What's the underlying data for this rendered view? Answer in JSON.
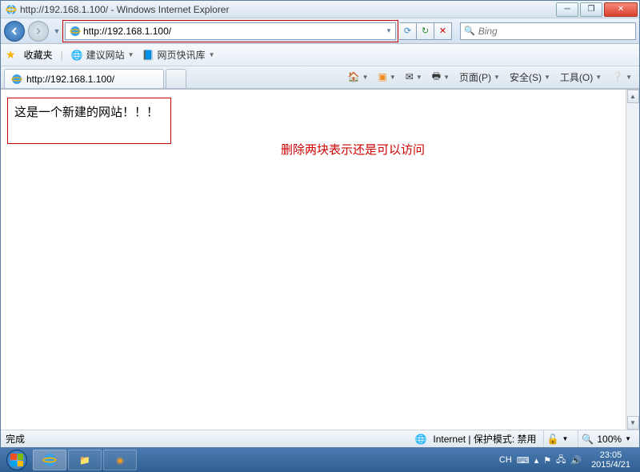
{
  "title": "http://192.168.1.100/ - Windows Internet Explorer",
  "address": {
    "url": "http://192.168.1.100/"
  },
  "search": {
    "placeholder": "Bing"
  },
  "favorites": {
    "label": "收藏夹",
    "suggest_label": "建议网站",
    "slice_label": "网页快讯库"
  },
  "tab": {
    "title": "http://192.168.1.100/"
  },
  "commands": {
    "page": "页面(P)",
    "safety": "安全(S)",
    "tools": "工具(O)"
  },
  "page_content": {
    "boxed_text": "这是一个新建的网站！！！",
    "annotation": "删除两块表示还是可以访问"
  },
  "status": {
    "done": "完成",
    "zone": "Internet | 保护模式: 禁用",
    "zoom": "100%"
  },
  "tray": {
    "ime": "CH",
    "time": "23:05",
    "date": "2015/4/21"
  }
}
